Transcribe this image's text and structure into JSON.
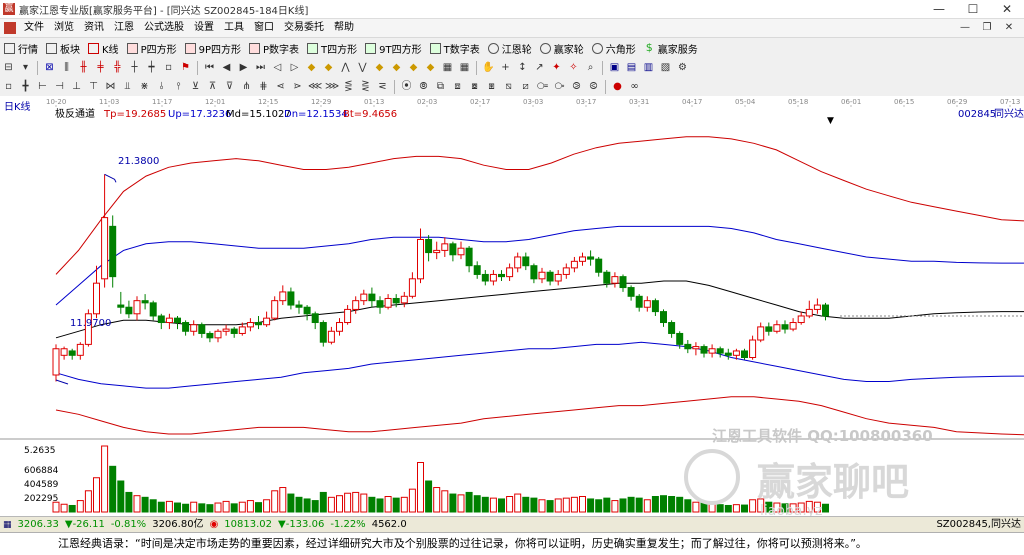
{
  "window": {
    "title": "赢家江恩专业版[赢家服务平台] - [同兴达  SZ002845-184日K线]",
    "controls": [
      "—",
      "☐",
      "✕"
    ],
    "mdi_controls": [
      "—",
      "❐",
      "✕"
    ]
  },
  "menu": [
    "文件",
    "浏览",
    "资讯",
    "江恩",
    "公式选股",
    "设置",
    "工具",
    "窗口",
    "交易委托",
    "帮助"
  ],
  "toolbar1": [
    {
      "label": "行情",
      "icon": "grid-icon"
    },
    {
      "label": "板块",
      "icon": "blocks-icon"
    },
    {
      "label": "K线",
      "icon": "kline-icon"
    },
    {
      "label": "P四方形",
      "icon": "p-square-icon"
    },
    {
      "label": "9P四方形",
      "icon": "9p-square-icon"
    },
    {
      "label": "P数字表",
      "icon": "p-table-icon"
    },
    {
      "label": "T四方形",
      "icon": "t-square-icon"
    },
    {
      "label": "9T四方形",
      "icon": "9t-square-icon"
    },
    {
      "label": "T数字表",
      "icon": "t-table-icon"
    },
    {
      "label": "江恩轮",
      "icon": "gann-wheel-icon"
    },
    {
      "label": "赢家轮",
      "icon": "winner-wheel-icon"
    },
    {
      "label": "六角形",
      "icon": "hexagon-icon"
    },
    {
      "label": "赢家服务",
      "icon": "dollar-icon"
    }
  ],
  "chart_header": {
    "period": "日K线",
    "indicator": "极反通道",
    "tp": "Tp=19.2685",
    "up": "Up=17.3236",
    "md": "Md=15.1027",
    "dn": "Dn=12.1534",
    "bt": "Bt=9.4656",
    "code": "002845",
    "name": "同兴达"
  },
  "date_ticks": [
    "10-20",
    "11-03",
    "11-17",
    "12-01",
    "12-15",
    "12-29",
    "01-13",
    "02-03",
    "02-17",
    "03-03",
    "03-17",
    "03-31",
    "04-17",
    "05-04",
    "05-18",
    "06-01",
    "06-15",
    "06-29",
    "07-13"
  ],
  "annotations": {
    "high": "21.3800",
    "low": "11.9700"
  },
  "volume_labels": {
    "max": "5.2635",
    "l1": "606884",
    "l2": "404589",
    "l3": "202295"
  },
  "watermark": {
    "line1": "江恩工具软件  QQ:100800360",
    "line2": "赢家聊吧",
    "line3": "liaoba.yz"
  },
  "statusbar": {
    "sh_index": "3206.33",
    "sh_change": "▼-26.11",
    "sh_pct": "-0.81%",
    "sh_amount": "3206.80亿",
    "sz_index": "10813.02",
    "sz_change": "▼-133.06",
    "sz_pct": "-1.22%",
    "sz_amount": "4562.0",
    "right": "SZ002845,同兴达"
  },
  "quote": "江恩经典语录：“时间是决定市场走势的重要因素，经过详细研究大市及个别股票的过往记录，你将可以证明，历史确实重复发生；而了解过往，你将可以预测将来。”。",
  "chart_data": {
    "type": "candlestick",
    "ylim": [
      9.5,
      23.5
    ],
    "colors": {
      "up": "#e00000",
      "down": "#008000",
      "tp": "#cc0000",
      "up_band": "#0000cc",
      "md": "#000000",
      "dn": "#0000cc",
      "bt": "#cc0000"
    },
    "last_values": {
      "tp": 19.2685,
      "up": 17.3236,
      "md": 15.1027,
      "dn": 12.1534,
      "bt": 9.4656
    },
    "extremes": {
      "high": 21.38,
      "low": 11.97
    },
    "candles": [
      [
        12.2,
        13.4,
        13.6,
        11.9
      ],
      [
        13.1,
        13.4,
        13.5,
        12.9
      ],
      [
        13.3,
        13.1,
        13.4,
        12.9
      ],
      [
        13.1,
        13.6,
        13.7,
        12.9
      ],
      [
        13.6,
        15.0,
        15.2,
        13.5
      ],
      [
        15.0,
        16.4,
        17.2,
        14.8
      ],
      [
        16.6,
        19.4,
        21.38,
        16.2
      ],
      [
        19.0,
        16.7,
        19.5,
        16.2
      ],
      [
        15.4,
        15.3,
        16.0,
        15.0
      ],
      [
        15.3,
        15.0,
        15.6,
        14.8
      ],
      [
        15.0,
        15.6,
        15.8,
        14.7
      ],
      [
        15.6,
        15.5,
        15.9,
        15.2
      ],
      [
        15.5,
        14.9,
        15.6,
        14.7
      ],
      [
        14.9,
        14.6,
        15.0,
        14.3
      ],
      [
        14.6,
        14.8,
        15.0,
        14.3
      ],
      [
        14.8,
        14.6,
        14.9,
        14.3
      ],
      [
        14.6,
        14.2,
        14.7,
        14.0
      ],
      [
        14.2,
        14.5,
        14.7,
        14.0
      ],
      [
        14.5,
        14.1,
        14.6,
        13.9
      ],
      [
        14.1,
        13.9,
        14.2,
        13.7
      ],
      [
        13.9,
        14.2,
        14.3,
        13.7
      ],
      [
        14.2,
        14.3,
        14.5,
        14.0
      ],
      [
        14.3,
        14.1,
        14.4,
        13.9
      ],
      [
        14.1,
        14.4,
        14.6,
        14.0
      ],
      [
        14.4,
        14.6,
        14.8,
        14.2
      ],
      [
        14.6,
        14.5,
        14.9,
        14.3
      ],
      [
        14.5,
        14.8,
        15.1,
        14.4
      ],
      [
        14.8,
        15.6,
        15.8,
        14.7
      ],
      [
        15.6,
        16.0,
        16.3,
        15.4
      ],
      [
        16.0,
        15.4,
        16.2,
        15.2
      ],
      [
        15.4,
        15.3,
        15.6,
        15.0
      ],
      [
        15.3,
        15.0,
        15.4,
        14.7
      ],
      [
        15.0,
        14.6,
        15.1,
        14.3
      ],
      [
        14.6,
        13.7,
        14.7,
        13.5
      ],
      [
        13.7,
        14.2,
        14.4,
        13.6
      ],
      [
        14.2,
        14.6,
        14.8,
        14.0
      ],
      [
        14.6,
        15.2,
        15.4,
        14.5
      ],
      [
        15.2,
        15.6,
        15.8,
        15.0
      ],
      [
        15.6,
        15.9,
        16.1,
        15.4
      ],
      [
        15.9,
        15.6,
        16.2,
        15.3
      ],
      [
        15.6,
        15.3,
        15.8,
        15.0
      ],
      [
        15.3,
        15.7,
        15.9,
        15.2
      ],
      [
        15.7,
        15.5,
        15.9,
        15.3
      ],
      [
        15.5,
        15.8,
        16.0,
        15.3
      ],
      [
        15.8,
        16.6,
        16.9,
        15.7
      ],
      [
        16.6,
        18.4,
        18.9,
        16.4
      ],
      [
        18.4,
        17.8,
        18.6,
        17.4
      ],
      [
        17.8,
        17.9,
        18.3,
        17.5
      ],
      [
        17.9,
        18.2,
        18.5,
        17.6
      ],
      [
        18.2,
        17.7,
        18.3,
        17.4
      ],
      [
        17.7,
        18.0,
        18.3,
        17.5
      ],
      [
        18.0,
        17.2,
        18.1,
        16.9
      ],
      [
        17.2,
        16.8,
        17.4,
        16.6
      ],
      [
        16.8,
        16.5,
        17.0,
        16.3
      ],
      [
        16.5,
        16.8,
        17.0,
        16.3
      ],
      [
        16.8,
        16.7,
        17.0,
        16.5
      ],
      [
        16.7,
        17.1,
        17.3,
        16.5
      ],
      [
        17.1,
        17.6,
        17.8,
        16.9
      ],
      [
        17.6,
        17.2,
        17.8,
        17.0
      ],
      [
        17.2,
        16.6,
        17.3,
        16.4
      ],
      [
        16.6,
        16.9,
        17.1,
        16.4
      ],
      [
        16.9,
        16.5,
        17.0,
        16.3
      ],
      [
        16.5,
        16.8,
        17.0,
        16.3
      ],
      [
        16.8,
        17.1,
        17.3,
        16.6
      ],
      [
        17.1,
        17.4,
        17.6,
        16.9
      ],
      [
        17.4,
        17.6,
        17.8,
        17.2
      ],
      [
        17.6,
        17.5,
        17.9,
        17.2
      ],
      [
        17.5,
        16.9,
        17.6,
        16.7
      ],
      [
        16.9,
        16.4,
        17.0,
        16.2
      ],
      [
        16.4,
        16.7,
        16.9,
        16.2
      ],
      [
        16.7,
        16.2,
        16.8,
        16.0
      ],
      [
        16.2,
        15.8,
        16.3,
        15.6
      ],
      [
        15.8,
        15.3,
        15.9,
        15.1
      ],
      [
        15.3,
        15.6,
        15.8,
        15.1
      ],
      [
        15.6,
        15.1,
        15.7,
        14.9
      ],
      [
        15.1,
        14.6,
        15.2,
        14.4
      ],
      [
        14.6,
        14.1,
        14.7,
        13.9
      ],
      [
        14.1,
        13.6,
        14.2,
        13.4
      ],
      [
        13.6,
        13.4,
        13.8,
        13.2
      ],
      [
        13.4,
        13.5,
        13.7,
        13.1
      ],
      [
        13.5,
        13.2,
        13.6,
        13.0
      ],
      [
        13.2,
        13.4,
        13.6,
        13.0
      ],
      [
        13.4,
        13.2,
        13.5,
        13.0
      ],
      [
        13.2,
        13.1,
        13.4,
        12.9
      ],
      [
        13.1,
        13.3,
        13.4,
        12.9
      ],
      [
        13.3,
        13.0,
        13.4,
        12.9
      ],
      [
        13.0,
        13.8,
        14.0,
        12.9
      ],
      [
        13.8,
        14.4,
        14.6,
        13.7
      ],
      [
        14.4,
        14.2,
        14.6,
        14.0
      ],
      [
        14.2,
        14.5,
        14.7,
        14.1
      ],
      [
        14.5,
        14.3,
        14.7,
        14.1
      ],
      [
        14.3,
        14.6,
        14.8,
        14.2
      ],
      [
        14.6,
        14.9,
        15.1,
        14.5
      ],
      [
        14.9,
        15.2,
        15.6,
        14.8
      ],
      [
        15.2,
        15.4,
        15.7,
        15.0
      ],
      [
        15.4,
        14.9,
        15.5,
        14.7
      ]
    ],
    "bands": {
      "tp": [
        16.8,
        17.9,
        19.3,
        20.6,
        21.3,
        21.7,
        21.9,
        22.0,
        22.1,
        22.0,
        21.8,
        21.6,
        21.6,
        21.7,
        21.9,
        22.1,
        22.2,
        22.2,
        22.1,
        21.8,
        21.6,
        21.6,
        21.9,
        22.3,
        22.6,
        22.8,
        22.9,
        23.0,
        23.1,
        23.1,
        23.0,
        22.8,
        22.5,
        22.0,
        21.5,
        21.1,
        20.7,
        20.4,
        20.1,
        19.9,
        19.7,
        19.5,
        19.3,
        19.25
      ],
      "up": [
        15.4,
        16.3,
        17.2,
        17.9,
        18.2,
        18.3,
        18.3,
        18.2,
        18.1,
        18.0,
        18.0,
        18.0,
        18.1,
        18.2,
        18.4,
        18.5,
        18.5,
        18.5,
        18.4,
        18.3,
        18.3,
        18.4,
        18.6,
        18.8,
        18.9,
        19.0,
        19.0,
        19.0,
        19.0,
        19.0,
        18.9,
        18.7,
        18.4,
        18.2,
        18.0,
        17.8,
        17.6,
        17.5,
        17.4,
        17.4,
        17.35,
        17.33,
        17.32,
        17.32
      ],
      "md": [
        13.9,
        14.2,
        14.5,
        14.7,
        14.7,
        14.6,
        14.5,
        14.5,
        14.5,
        14.6,
        14.8,
        14.9,
        15.0,
        15.1,
        15.3,
        15.4,
        15.5,
        15.6,
        15.7,
        15.8,
        15.9,
        16.0,
        16.1,
        16.2,
        16.3,
        16.4,
        16.4,
        16.5,
        16.5,
        16.3,
        16.0,
        15.7,
        15.4,
        15.1,
        14.9,
        14.8,
        14.8,
        14.8,
        14.9,
        15.0,
        15.05,
        15.08,
        15.1,
        15.1
      ],
      "dn": [
        12.3,
        12.0,
        11.8,
        11.7,
        11.6,
        11.6,
        11.7,
        11.8,
        11.9,
        12.0,
        12.1,
        12.3,
        12.4,
        12.5,
        12.7,
        12.8,
        12.9,
        13.0,
        13.1,
        13.2,
        13.3,
        13.4,
        13.4,
        13.5,
        13.6,
        13.6,
        13.7,
        13.6,
        13.5,
        13.3,
        13.0,
        12.8,
        12.6,
        12.4,
        12.2,
        12.0,
        11.9,
        11.9,
        12.0,
        12.05,
        12.1,
        12.12,
        12.14,
        12.15
      ],
      "bt": [
        10.6,
        10.4,
        10.1,
        9.8,
        9.6,
        9.5,
        9.5,
        9.6,
        9.7,
        9.8,
        9.8,
        9.8,
        9.7,
        9.6,
        9.6,
        9.7,
        9.8,
        9.9,
        10.0,
        10.2,
        10.3,
        10.4,
        10.5,
        10.6,
        10.7,
        10.8,
        10.8,
        10.9,
        11.0,
        11.1,
        11.2,
        11.2,
        11.1,
        11.0,
        10.8,
        10.5,
        10.2,
        10.0,
        9.9,
        9.8,
        9.6,
        9.55,
        9.5,
        9.47
      ]
    },
    "volume_max": 809179,
    "volume": [
      120000,
      95000,
      80000,
      140000,
      260000,
      420000,
      809179,
      560000,
      380000,
      240000,
      200000,
      180000,
      150000,
      120000,
      130000,
      110000,
      95000,
      120000,
      100000,
      90000,
      110000,
      130000,
      100000,
      120000,
      140000,
      115000,
      150000,
      260000,
      300000,
      220000,
      180000,
      160000,
      140000,
      240000,
      180000,
      200000,
      230000,
      240000,
      220000,
      180000,
      160000,
      190000,
      170000,
      180000,
      280000,
      606884,
      380000,
      300000,
      260000,
      220000,
      210000,
      240000,
      200000,
      180000,
      170000,
      160000,
      190000,
      220000,
      180000,
      170000,
      150000,
      140000,
      160000,
      170000,
      180000,
      190000,
      160000,
      150000,
      170000,
      140000,
      160000,
      180000,
      170000,
      150000,
      190000,
      200000,
      190000,
      180000,
      150000,
      120000,
      110000,
      100000,
      90000,
      80000,
      90000,
      85000,
      150000,
      160000,
      120000,
      110000,
      100000,
      100000,
      110000,
      130000,
      120000,
      95000
    ]
  }
}
